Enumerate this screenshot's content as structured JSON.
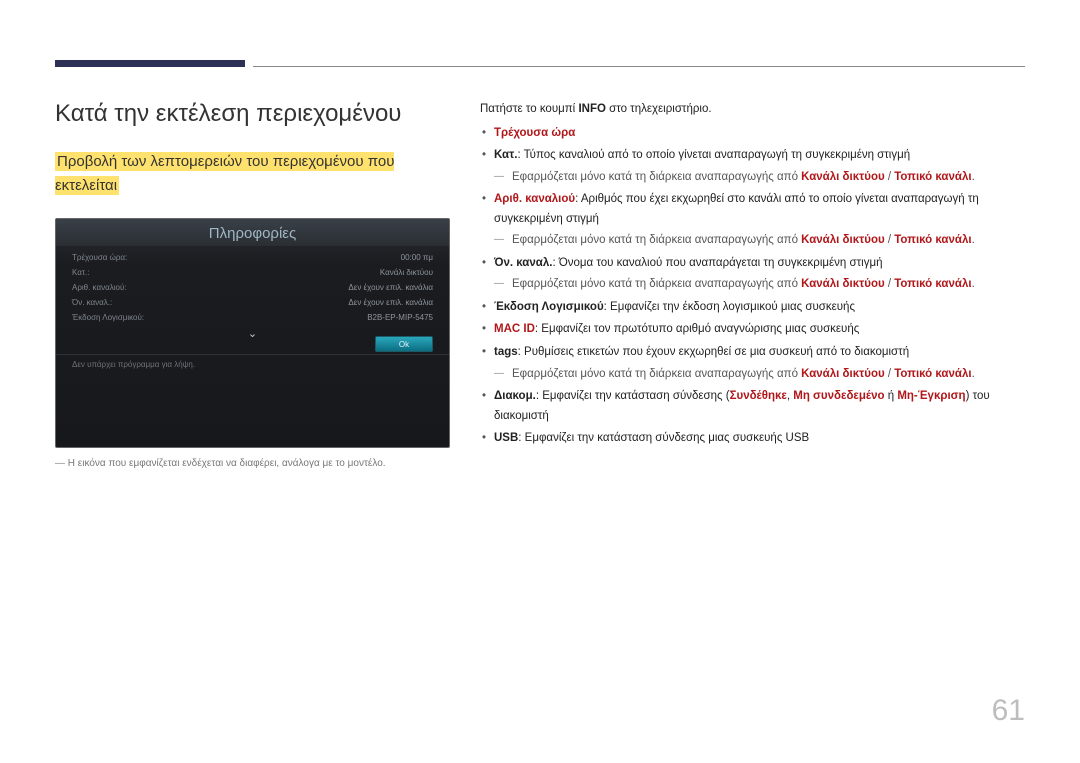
{
  "page_number": "61",
  "heading": "Κατά την εκτέλεση περιεχομένου",
  "subheading": "Προβολή των λεπτομερειών του περιεχομένου που εκτελείται",
  "device": {
    "title": "Πληροφορίες",
    "rows": [
      {
        "label": "Τρέχουσα ώρα:",
        "value": "00:00 πμ"
      },
      {
        "label": "Κατ.:",
        "value": "Κανάλι δικτύου"
      },
      {
        "label": "Αριθ. καναλιού:",
        "value": "Δεν έχουν επιλ. κανάλια"
      },
      {
        "label": "Όν. καναλ.:",
        "value": "Δεν έχουν επιλ. κανάλια"
      },
      {
        "label": "Έκδοση Λογισμικού:",
        "value": "B2B-EP-MIP-5475"
      }
    ],
    "ok": "Ok",
    "footer": "Δεν υπάρχει πρόγραμμα για λήψη."
  },
  "image_note": "Η εικόνα που εμφανίζεται ενδέχεται να διαφέρει, ανάλογα με το μοντέλο.",
  "right": {
    "intro_pre": "Πατήστε το κουμπί ",
    "intro_bold": "INFO",
    "intro_post": " στο τηλεχειριστήριο.",
    "items": {
      "time": "Τρέχουσα ώρα",
      "cat_label": "Κατ.",
      "cat_text": ": Τύπος καναλιού από το οποίο γίνεται αναπαραγωγή τη συγκεκριμένη στιγμή",
      "sub_apply_pre": "Εφαρμόζεται μόνο κατά τη διάρκεια αναπαραγωγής από ",
      "sub_apply_a": "Κανάλι δικτύου",
      "sub_apply_sep": " / ",
      "sub_apply_b": "Τοπικό κανάλι",
      "chnum_label": "Αριθ. καναλιού",
      "chnum_text": ": Αριθμός που έχει εκχωρηθεί στο κανάλι από το οποίο γίνεται αναπαραγωγή τη συγκεκριμένη στιγμή",
      "chname_label": "Όν. καναλ.",
      "chname_text": ": Όνομα του καναλιού που αναπαράγεται τη συγκεκριμένη στιγμή",
      "sw_label": "Έκδοση Λογισμικού",
      "sw_text": ": Εμφανίζει την έκδοση λογισμικού μιας συσκευής",
      "mac_label": "MAC ID",
      "mac_text": ": Εμφανίζει τον πρωτότυπο αριθμό αναγνώρισης μιας συσκευής",
      "tags_label": "tags",
      "tags_text": ": Ρυθμίσεις ετικετών που έχουν εκχωρηθεί σε μια συσκευή από το διακομιστή",
      "conn_label": "Διακομ.",
      "conn_pre": ": Εμφανίζει την κατάσταση σύνδεσης (",
      "conn_a": "Συνδέθηκε",
      "conn_s1": ", ",
      "conn_b": "Μη συνδεδεμένο",
      "conn_s2": " ή ",
      "conn_c": "Μη-Έγκριση",
      "conn_post": ") του διακομιστή",
      "usb_label": "USB",
      "usb_text": ": Εμφανίζει την κατάσταση σύνδεσης μιας συσκευής USB"
    }
  }
}
